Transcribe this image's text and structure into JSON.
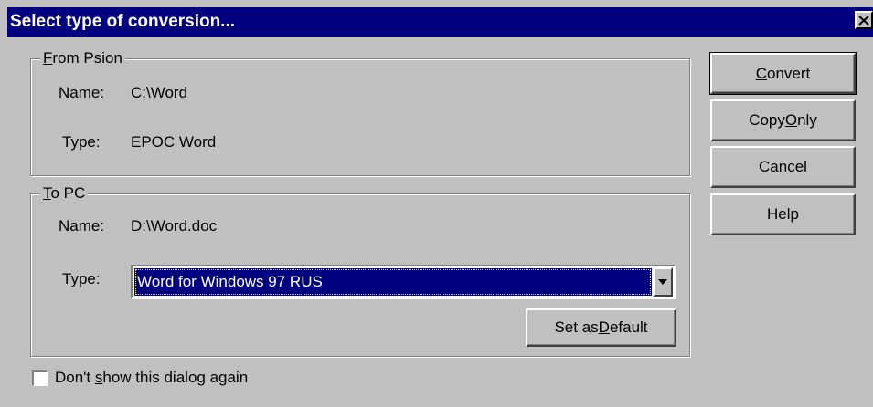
{
  "window": {
    "title": "Select type of conversion...",
    "close_glyph": "✕"
  },
  "from_psion": {
    "legend_pre": "",
    "legend_mnemonic": "F",
    "legend_post": "rom Psion",
    "name_label": "Name:",
    "name_value": "C:\\Word",
    "type_label": "Type:",
    "type_value": "EPOC Word"
  },
  "to_pc": {
    "legend_pre": "",
    "legend_mnemonic": "T",
    "legend_post": "o PC",
    "name_label": "Name:",
    "name_value": "D:\\Word.doc",
    "type_label": "Type:",
    "type_selected": "Word for Windows 97 RUS",
    "set_default_pre": "Set as ",
    "set_default_mnemonic": "D",
    "set_default_post": "efault"
  },
  "buttons": {
    "convert_pre": "",
    "convert_mnemonic": "C",
    "convert_post": "onvert",
    "copy_only_pre": "Copy ",
    "copy_only_mnemonic": "O",
    "copy_only_post": "nly",
    "cancel": "Cancel",
    "help": "Help"
  },
  "dont_show": {
    "pre": "Don't ",
    "mnemonic": "s",
    "post": "how this dialog again",
    "checked": false
  },
  "colors": {
    "face": "#c0c0c0",
    "title_bar": "#000080",
    "selection": "#000080"
  },
  "icons": {
    "close": "close-icon",
    "dropdown": "dropdown-arrow-icon"
  }
}
